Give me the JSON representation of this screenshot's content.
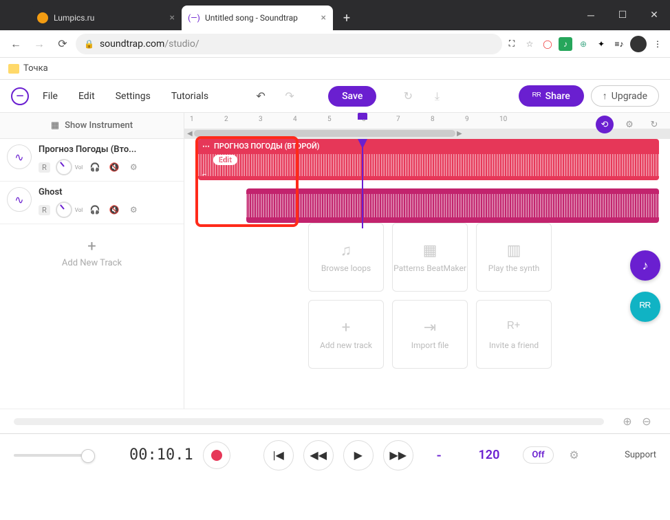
{
  "browser": {
    "tabs": [
      {
        "title": "Lumpics.ru",
        "active": false
      },
      {
        "title": "Untitled song - Soundtrap",
        "active": true,
        "prefix": "(—)"
      }
    ],
    "url_domain": "soundtrap.com",
    "url_path": "/studio/",
    "bookmark": "Точка"
  },
  "toolbar": {
    "menus": [
      "File",
      "Edit",
      "Settings",
      "Tutorials"
    ],
    "save": "Save",
    "share": "Share",
    "upgrade": "Upgrade"
  },
  "sidebar": {
    "show_instrument": "Show Instrument",
    "add_new_track": "Add New Track",
    "tracks": [
      {
        "name": "Прогноз Погоды (Вто...",
        "vol_label": "Vol"
      },
      {
        "name": "Ghost",
        "vol_label": "Vol"
      }
    ]
  },
  "ruler": {
    "numbers": [
      "1",
      "2",
      "3",
      "4",
      "5",
      "6",
      "7",
      "8",
      "9",
      "10"
    ]
  },
  "clips": {
    "clip1_name": "ПРОГНОЗ ПОГОДЫ (ВТОРОЙ)",
    "edit": "Edit"
  },
  "dropzone": [
    {
      "label": "Browse loops"
    },
    {
      "label": "Patterns BeatMaker"
    },
    {
      "label": "Play the synth"
    },
    {
      "label": "Add new track"
    },
    {
      "label": "Import file"
    },
    {
      "label": "Invite a friend"
    }
  ],
  "transport": {
    "time": "00:10.1",
    "key": "-",
    "bpm": "120",
    "metronome": "Off",
    "support": "Support"
  }
}
